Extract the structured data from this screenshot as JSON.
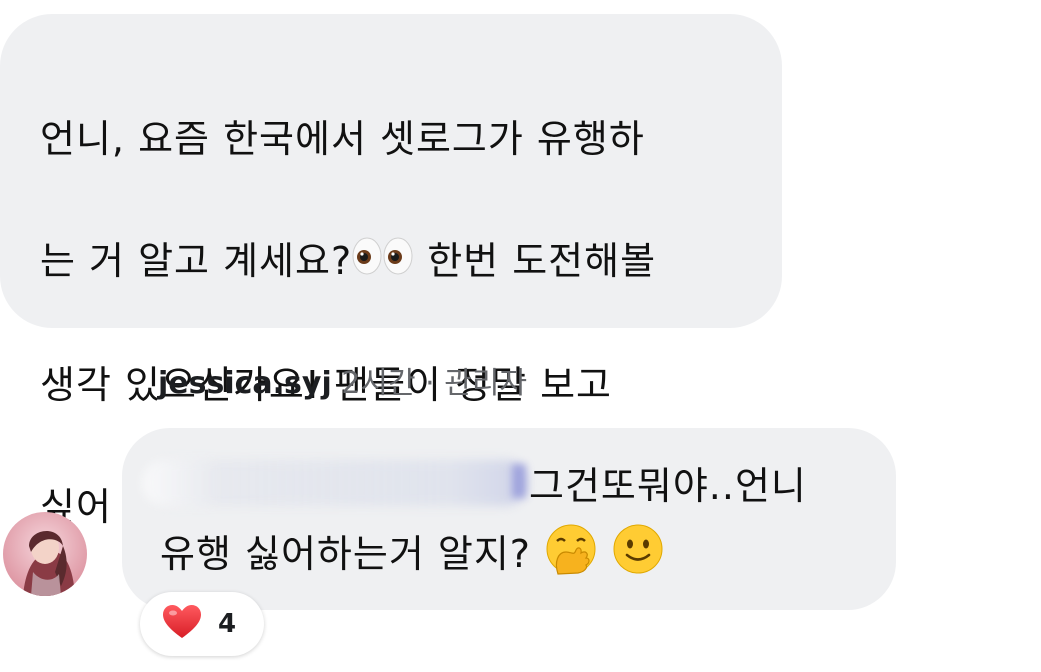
{
  "top_comment": {
    "line1": "언니, 요즘 한국에서 셋로그가 유행하",
    "line2": "는 거 알고 계세요?",
    "line2b": " 한번 도전해볼",
    "line3": "생각 있으신가요! 팬들이 정말 보고",
    "line4": "싶어 죽겠어요!",
    "emoji": "eyes-emoji"
  },
  "reply": {
    "username": "jessica.syj",
    "time": "2시간",
    "separator": "·",
    "role": "관리자",
    "line1": "그건또뭐야..언니",
    "line2": "유행 싫어하는거 알지?",
    "emojis": [
      "hand-over-mouth-emoji",
      "slightly-smiling-emoji"
    ]
  },
  "reaction": {
    "icon": "heart-icon",
    "count": "4",
    "color": "#e0242b"
  },
  "colors": {
    "bubble": "#eff0f2",
    "secondary_text": "#65676b"
  }
}
